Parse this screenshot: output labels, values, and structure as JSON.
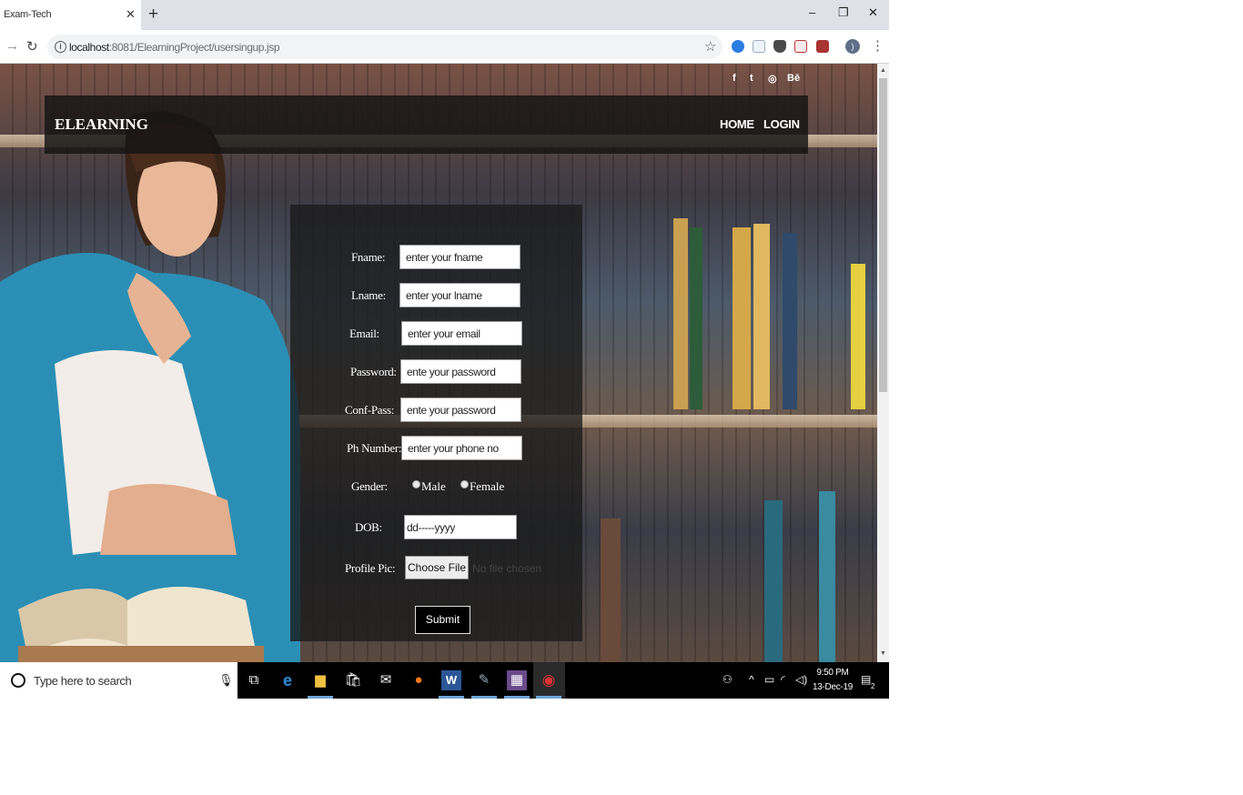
{
  "browser": {
    "tab_title": "Exam-Tech",
    "tab_close": "✕",
    "new_tab": "+",
    "url_host": "localhost",
    "url_rest": ":8081/ElearningProject/usersingup.jsp",
    "window": {
      "minimize": "–",
      "restore": "❐",
      "close": "✕"
    }
  },
  "page": {
    "social": [
      "f",
      "t",
      "◎",
      "Bē"
    ],
    "brand": "ELEARNING",
    "nav": {
      "home": "HOME",
      "login": "LOGIN"
    },
    "form": {
      "fname_label": "Fname:",
      "fname_placeholder": "enter your fname",
      "lname_label": "Lname:",
      "lname_placeholder": "enter your lname",
      "email_label": "Email:",
      "email_placeholder": "enter your email",
      "password_label": "Password:",
      "password_placeholder": "ente your password",
      "confpass_label": "Conf-Pass:",
      "confpass_placeholder": "ente your password",
      "phone_label": "Ph Number:",
      "phone_placeholder": "enter your phone no",
      "gender_label": "Gender:",
      "gender_male": "Male",
      "gender_female": "Female",
      "dob_label": "DOB:",
      "dob_placeholder": "dd-----yyyy",
      "pic_label": "Profile Pic:",
      "choose_file": "Choose File",
      "file_status": "No file chosen",
      "submit": "Submit"
    }
  },
  "taskbar": {
    "search_placeholder": "Type here to search",
    "time": "9:50 PM",
    "date": "13-Dec-19",
    "notifications": "2"
  }
}
